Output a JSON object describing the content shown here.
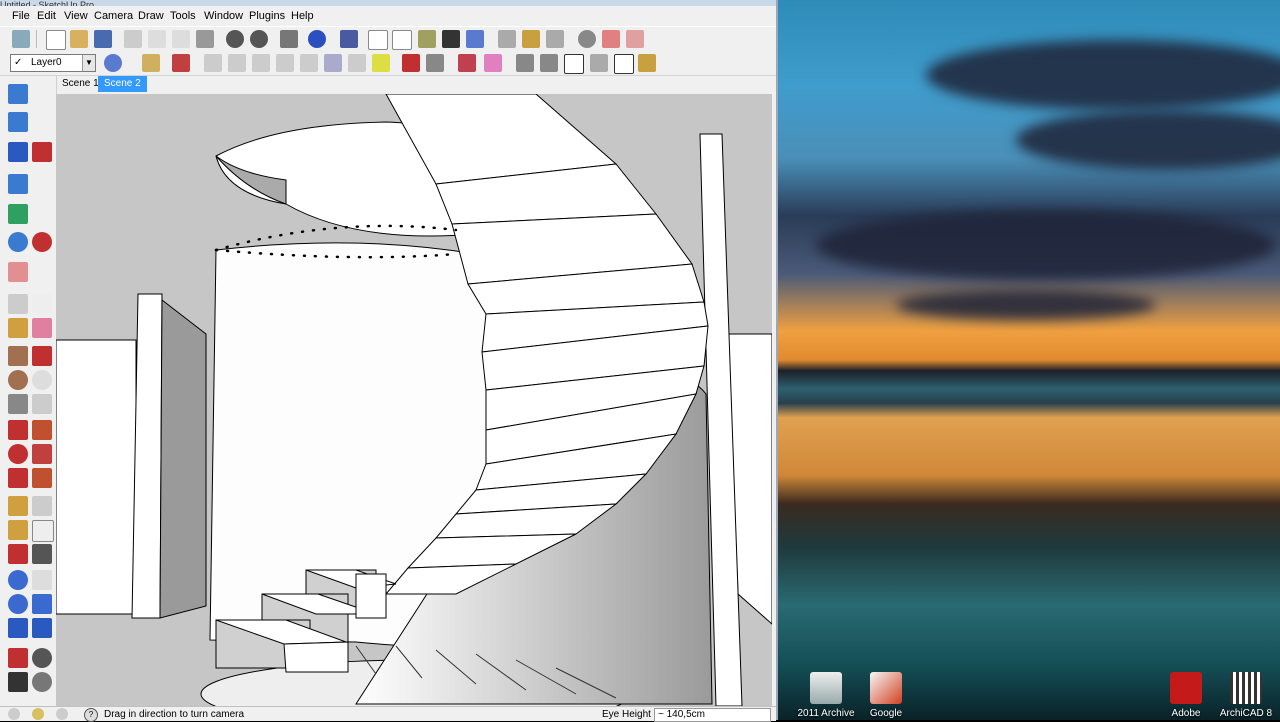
{
  "window": {
    "title": "Untitled - SketchUp Pro"
  },
  "menu": [
    "File",
    "Edit",
    "View",
    "Camera",
    "Draw",
    "Tools",
    "Window",
    "Plugins",
    "Help"
  ],
  "layer": {
    "current": "Layer0"
  },
  "scenes": [
    {
      "label": "Scene 1",
      "active": false
    },
    {
      "label": "Scene 2",
      "active": true
    }
  ],
  "status": {
    "message": "Drag in direction to turn camera",
    "measure_label": "Eye Height",
    "measure_value": "~ 140,5cm"
  },
  "desktop_icons": [
    {
      "label": "2011 Archive",
      "icon": "archive-icon"
    },
    {
      "label": "Google",
      "icon": "sketchup-icon"
    },
    {
      "label": "Adobe",
      "icon": "pdf-icon"
    },
    {
      "label": "ArchiCAD 8",
      "icon": "archicad-icon"
    }
  ],
  "colors": {
    "accent": "#3399ff",
    "viewport_bg": "#c8c8c8",
    "geometry": "#ffffff"
  }
}
